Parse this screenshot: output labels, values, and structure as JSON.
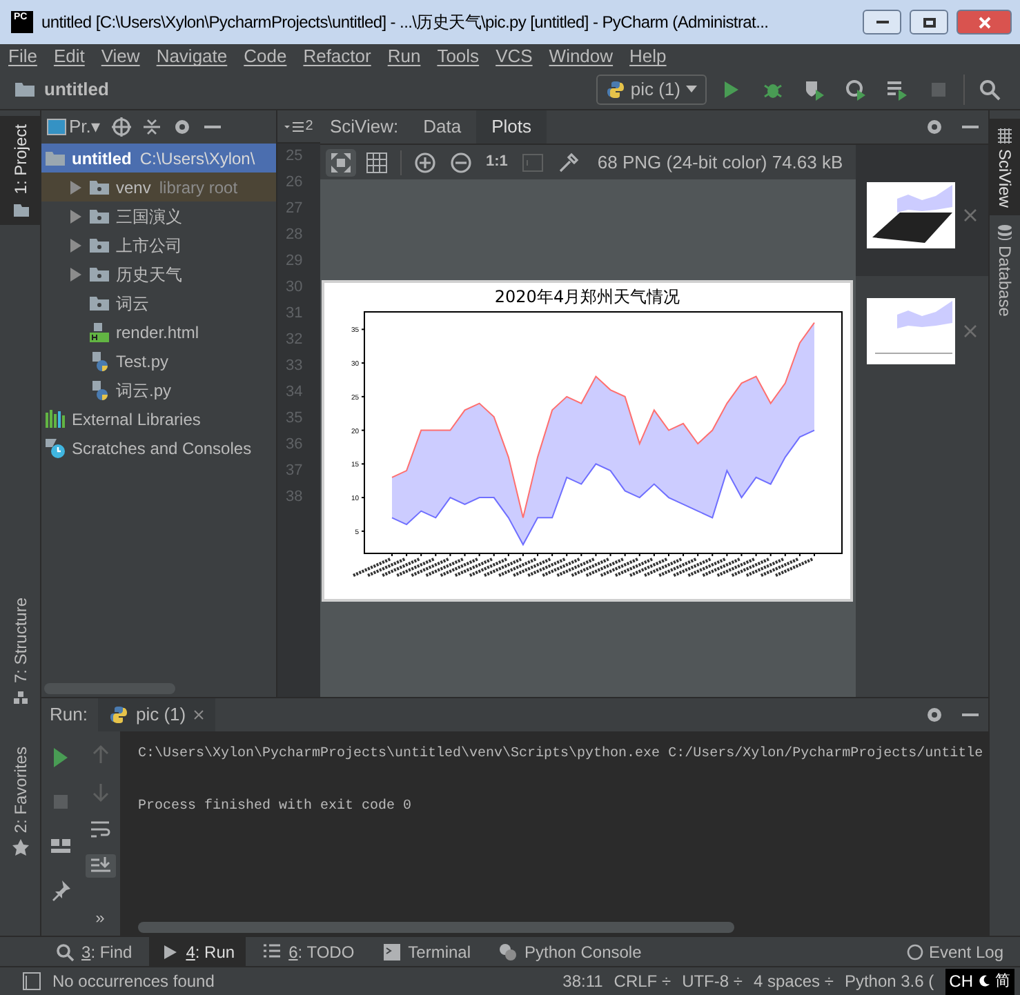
{
  "window": {
    "logo": "PC",
    "title": "untitled [C:\\Users\\Xylon\\PycharmProjects\\untitled] - ...\\历史天气\\pic.py [untitled] - PyCharm (Administrat..."
  },
  "menu": [
    {
      "label": "File"
    },
    {
      "label": "Edit"
    },
    {
      "label": "View"
    },
    {
      "label": "Navigate"
    },
    {
      "label": "Code"
    },
    {
      "label": "Refactor"
    },
    {
      "label": "Run"
    },
    {
      "label": "Tools"
    },
    {
      "label": "VCS"
    },
    {
      "label": "Window"
    },
    {
      "label": "Help"
    }
  ],
  "navbar": {
    "project": "untitled",
    "run_config": "pic (1)"
  },
  "left_stripe": [
    {
      "label": "1: Project",
      "selected": true
    },
    {
      "label": "7: Structure",
      "selected": false
    },
    {
      "label": "2: Favorites",
      "selected": false
    }
  ],
  "project_panel": {
    "header": "Pr.▾",
    "tree": [
      {
        "kind": "root",
        "name": "untitled",
        "note": "C:\\Users\\Xylon\\",
        "selected": true,
        "children": [
          {
            "kind": "folder",
            "name": "venv",
            "note": "library root",
            "expandable": true,
            "highlighted": true
          },
          {
            "kind": "folder",
            "name": "三国演义",
            "expandable": true,
            "highlighted": false
          },
          {
            "kind": "folder",
            "name": "上市公司",
            "expandable": true,
            "highlighted": false
          },
          {
            "kind": "folder",
            "name": "历史天气",
            "expandable": true,
            "highlighted": false
          },
          {
            "kind": "folder",
            "name": "词云",
            "expandable": false,
            "highlighted": false
          },
          {
            "kind": "html",
            "name": "render.html",
            "expandable": false,
            "highlighted": false
          },
          {
            "kind": "python",
            "name": "Test.py",
            "expandable": false,
            "highlighted": false
          },
          {
            "kind": "python",
            "name": "词云.py",
            "expandable": false,
            "highlighted": false
          }
        ]
      },
      {
        "kind": "libraries",
        "name": "External Libraries",
        "selected": false
      },
      {
        "kind": "scratches",
        "name": "Scratches and Consoles",
        "selected": false
      }
    ]
  },
  "gutter": {
    "badge": "2",
    "line_numbers": [
      "25",
      "26",
      "27",
      "28",
      "29",
      "30",
      "31",
      "32",
      "33",
      "34",
      "35",
      "36",
      "37",
      "38"
    ]
  },
  "sciview": {
    "label": "SciView:",
    "tabs": [
      {
        "label": "Data",
        "selected": false
      },
      {
        "label": "Plots",
        "selected": true
      }
    ],
    "zoom_label": "1:1",
    "image_info": "68 PNG (24-bit color) 74.63 kB",
    "chart_data": {
      "type": "area",
      "title": "2020年4月郑州天气情况",
      "ylim": [
        1.7,
        37.6
      ],
      "yticks": [
        5,
        10,
        15,
        20,
        25,
        30,
        35
      ],
      "series": [
        {
          "type": "area",
          "color": "#ccccff",
          "values": [
            13,
            14,
            20,
            20,
            20,
            23,
            24,
            22,
            16,
            7,
            16,
            23,
            25,
            24,
            28,
            26,
            25,
            18,
            23,
            20,
            21,
            18,
            20,
            24,
            27,
            28,
            24,
            27,
            33,
            36
          ]
        },
        {
          "type": "line",
          "color": "#ff6f6f",
          "values": [
            13,
            14,
            20,
            20,
            20,
            23,
            24,
            22,
            16,
            7,
            16,
            23,
            25,
            24,
            28,
            26,
            25,
            18,
            23,
            20,
            21,
            18,
            20,
            24,
            27,
            28,
            24,
            27,
            33,
            36
          ]
        },
        {
          "type": "line",
          "color": "#6f6fff",
          "values": [
            7,
            6,
            8,
            7,
            10,
            9,
            10,
            10,
            7,
            3,
            7,
            7,
            13,
            12,
            15,
            14,
            11,
            10,
            12,
            10,
            9,
            8,
            7,
            14,
            10,
            13,
            12,
            16,
            19,
            20
          ]
        }
      ]
    },
    "thumbnails": [
      {
        "selected": true
      },
      {
        "selected": false
      }
    ]
  },
  "right_stripe": [
    {
      "label": "SciView",
      "selected": true
    },
    {
      "label": "Database",
      "selected": false
    }
  ],
  "run_panel": {
    "label": "Run:",
    "tab": "pic (1)",
    "lines": [
      "C:\\Users\\Xylon\\PycharmProjects\\untitled\\venv\\Scripts\\python.exe C:/Users/Xylon/PycharmProjects/untitle",
      "Process finished with exit code 0"
    ],
    "more": "»"
  },
  "tool_tabs": [
    {
      "kind": "find",
      "key": "3",
      "label": ": Find",
      "selected": false
    },
    {
      "kind": "run",
      "key": "4",
      "label": ": Run",
      "selected": true
    },
    {
      "kind": "todo",
      "key": "6",
      "label": ": TODO",
      "selected": false
    },
    {
      "kind": "terminal",
      "label": "Terminal",
      "selected": false
    },
    {
      "kind": "console",
      "label": "Python Console",
      "selected": false
    }
  ],
  "event_log": "Event Log",
  "status_bar": {
    "message": "No occurrences found",
    "items": [
      "38:11",
      "CRLF ÷",
      "UTF-8 ÷",
      "4 spaces ÷",
      "Python 3.6 ("
    ],
    "ime": [
      "CH",
      "简"
    ]
  }
}
